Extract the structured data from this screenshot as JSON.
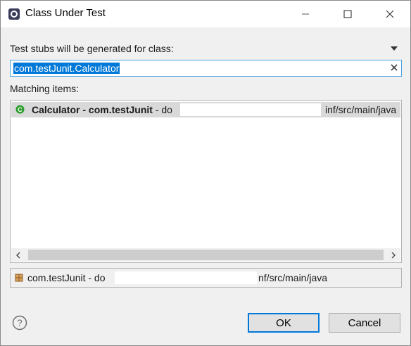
{
  "window": {
    "title": "Class Under Test"
  },
  "prompt": {
    "label": "Test stubs will be generated for class:"
  },
  "search": {
    "value": "com.testJunit.Calculator"
  },
  "matching": {
    "label": "Matching items:",
    "items": [
      {
        "class_name": "Calculator",
        "separator": " - ",
        "package": "com.testJunit",
        "path_prefix": " - do",
        "path_suffix": "inf/src/main/java"
      }
    ]
  },
  "details": {
    "package": "com.testJunit",
    "path_prefix": " - do",
    "path_suffix": "nf/src/main/java"
  },
  "buttons": {
    "ok": "OK",
    "cancel": "Cancel"
  },
  "colors": {
    "accent": "#0078d7",
    "selection_row": "#d9d9d9",
    "class_icon": "#2e9e2e"
  },
  "icons": [
    "eclipse-app-icon",
    "minimize-icon",
    "maximize-icon",
    "close-icon",
    "view-menu-icon",
    "clear-icon",
    "class-icon",
    "package-icon",
    "help-icon",
    "chevron-left-icon",
    "chevron-right-icon"
  ]
}
